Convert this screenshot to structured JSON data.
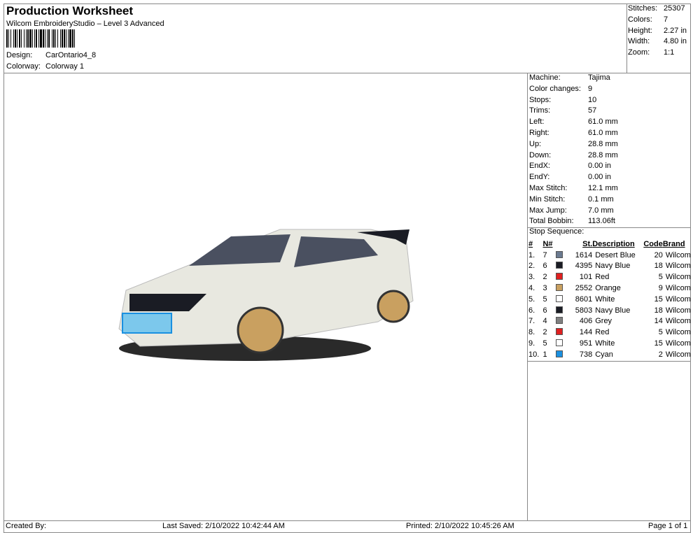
{
  "header": {
    "title": "Production Worksheet",
    "subtitle": "Wilcom EmbroideryStudio – Level 3 Advanced",
    "design_label": "Design:",
    "design": "CarOntario4_8",
    "colorway_label": "Colorway:",
    "colorway": "Colorway 1"
  },
  "stats": [
    {
      "k": "Stitches:",
      "v": "25307"
    },
    {
      "k": "Colors:",
      "v": "7"
    },
    {
      "k": "Height:",
      "v": "2.27 in"
    },
    {
      "k": "Width:",
      "v": "4.80 in"
    },
    {
      "k": "Zoom:",
      "v": "1:1"
    }
  ],
  "info": [
    {
      "k": "Machine:",
      "v": "Tajima"
    },
    {
      "k": "Color changes:",
      "v": "9"
    },
    {
      "k": "Stops:",
      "v": "10"
    },
    {
      "k": "Trims:",
      "v": "57"
    },
    {
      "k": "Left:",
      "v": "61.0 mm"
    },
    {
      "k": "Right:",
      "v": "61.0 mm"
    },
    {
      "k": "Up:",
      "v": "28.8 mm"
    },
    {
      "k": "Down:",
      "v": "28.8 mm"
    },
    {
      "k": "EndX:",
      "v": "0.00 in"
    },
    {
      "k": "EndY:",
      "v": "0.00 in"
    },
    {
      "k": "Max Stitch:",
      "v": "12.1 mm"
    },
    {
      "k": "Min Stitch:",
      "v": "0.1 mm"
    },
    {
      "k": "Max Jump:",
      "v": "7.0 mm"
    },
    {
      "k": "Total Bobbin:",
      "v": "113.06ft"
    }
  ],
  "stop_sequence": {
    "title": "Stop Sequence:",
    "headers": [
      "#",
      "N#",
      "St.",
      "Description",
      "Code",
      "Brand"
    ],
    "rows": [
      {
        "n": "1.",
        "needle": "7",
        "color": "#6b7a90",
        "st": "1614",
        "desc": "Desert Blue",
        "code": "20",
        "brand": "Wilcom"
      },
      {
        "n": "2.",
        "needle": "6",
        "color": "#1a1c24",
        "st": "4395",
        "desc": "Navy Blue",
        "code": "18",
        "brand": "Wilcom"
      },
      {
        "n": "3.",
        "needle": "2",
        "color": "#e02020",
        "st": "101",
        "desc": "Red",
        "code": "5",
        "brand": "Wilcom"
      },
      {
        "n": "4.",
        "needle": "3",
        "color": "#c9a060",
        "st": "2552",
        "desc": "Orange",
        "code": "9",
        "brand": "Wilcom"
      },
      {
        "n": "5.",
        "needle": "5",
        "color": "#ffffff",
        "st": "8601",
        "desc": "White",
        "code": "15",
        "brand": "Wilcom"
      },
      {
        "n": "6.",
        "needle": "6",
        "color": "#1a1c24",
        "st": "5803",
        "desc": "Navy Blue",
        "code": "18",
        "brand": "Wilcom"
      },
      {
        "n": "7.",
        "needle": "4",
        "color": "#808080",
        "st": "406",
        "desc": "Grey",
        "code": "14",
        "brand": "Wilcom"
      },
      {
        "n": "8.",
        "needle": "2",
        "color": "#e02020",
        "st": "144",
        "desc": "Red",
        "code": "5",
        "brand": "Wilcom"
      },
      {
        "n": "9.",
        "needle": "5",
        "color": "#ffffff",
        "st": "951",
        "desc": "White",
        "code": "15",
        "brand": "Wilcom"
      },
      {
        "n": "10.",
        "needle": "1",
        "color": "#1a90e0",
        "st": "738",
        "desc": "Cyan",
        "code": "2",
        "brand": "Wilcom"
      }
    ]
  },
  "footer": {
    "created": "Created By:",
    "saved": "Last Saved: 2/10/2022 10:42:44 AM",
    "printed": "Printed: 2/10/2022 10:45:26 AM",
    "page": "Page 1 of 1"
  }
}
